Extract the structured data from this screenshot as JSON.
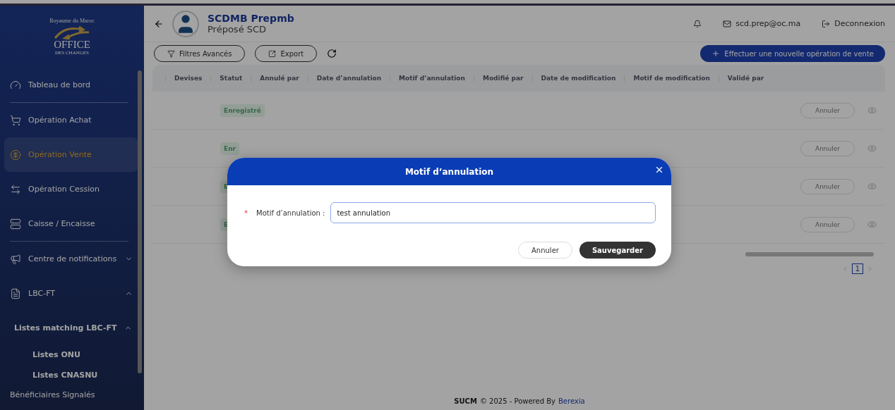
{
  "sidebar": {
    "logo": {
      "top_text": "Royaume du Maroc",
      "name": "OFFICE",
      "subtitle": "DES CHANGES"
    },
    "items": [
      {
        "label": "Tableau de bord",
        "selected": false
      },
      {
        "label": "Opération Achat",
        "selected": false
      },
      {
        "label": "Opération Vente",
        "selected": true
      },
      {
        "label": "Opération Cession",
        "selected": false
      },
      {
        "label": "Caisse / Encaisse",
        "selected": false
      },
      {
        "label": "Centre de notifications",
        "selected": false,
        "expanded": false
      },
      {
        "label": "LBC-FT",
        "selected": false,
        "expanded": true,
        "children": [
          {
            "label": "Listes matching LBC-FT",
            "expanded": true,
            "children": [
              {
                "label": "Listes ONU"
              },
              {
                "label": "Listes CNASNU"
              }
            ]
          }
        ]
      },
      {
        "label": "Bénéficiaires Signalés",
        "selected": false
      }
    ]
  },
  "header": {
    "user_name": "SCDMB Prepmb",
    "role": "Préposé SCD",
    "email": "scd.prep@oc.ma",
    "logout": "Deconnexion"
  },
  "toolbar": {
    "filters": "Filtres Avancés",
    "export": "Export",
    "new_operation": "Effectuer une nouvelle opération de vente"
  },
  "table": {
    "columns": [
      "Devises",
      "Statut",
      "Annulé par",
      "Date d’annulation",
      "Motif d’annulation",
      "Modifié par",
      "Date de modification",
      "Motif de modification",
      "Validé par"
    ],
    "rows": [
      {
        "status": "Enregistré",
        "action": "Annuler"
      },
      {
        "status": "Enr",
        "action": "Annuler"
      },
      {
        "status": "E",
        "action": "Annuler"
      },
      {
        "status": "E",
        "action": "Annuler"
      }
    ],
    "page": "1"
  },
  "modal": {
    "title": "Motif d’annulation",
    "field_label": "Motif d’annulation :",
    "required_mark": "*",
    "value": "test annulation",
    "cancel": "Annuler",
    "save": "Sauvegarder"
  },
  "footer": {
    "brand": "SUCM",
    "text": "© 2025 - Powered By",
    "link": "Berexia"
  }
}
